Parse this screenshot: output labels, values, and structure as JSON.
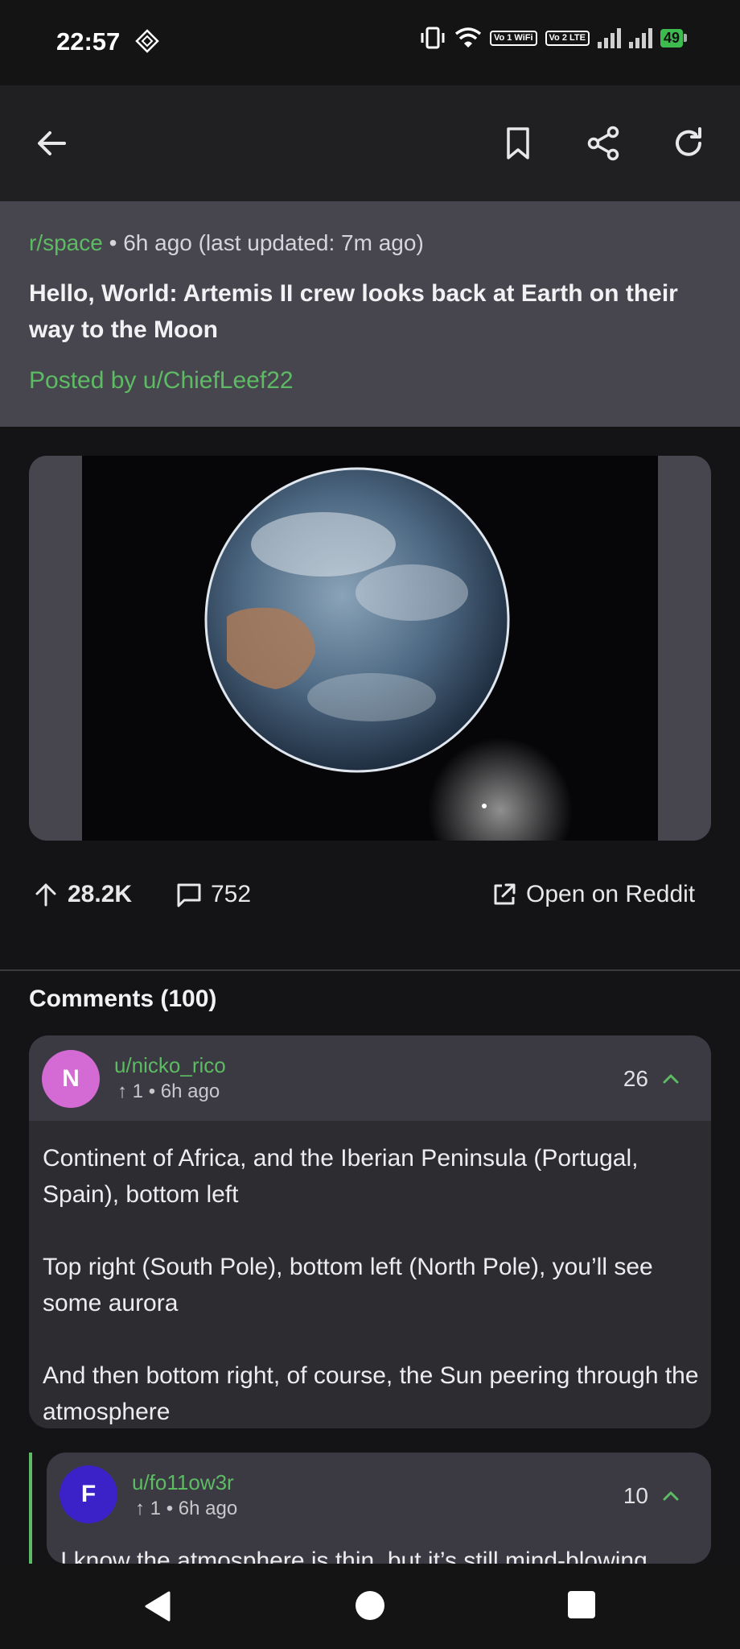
{
  "status_bar": {
    "time": "22:57",
    "sim1": "Vo 1 WiFi",
    "sim2": "Vo 2 LTE",
    "battery": "49",
    "icons": [
      "diamond-icon",
      "vibrate-icon",
      "wifi-icon",
      "signal-icon",
      "battery-icon"
    ]
  },
  "toolbar": {
    "icons": [
      "back-arrow-icon",
      "bookmark-icon",
      "share-icon",
      "refresh-icon"
    ]
  },
  "post": {
    "subreddit": "r/space",
    "time_meta": "• 6h ago (last updated: 7m ago)",
    "title": "Hello, World: Artemis II crew looks back at Earth on their way to the Moon",
    "author_line": "Posted by u/ChiefLeef22",
    "upvotes": "28.2K",
    "comment_count": "752",
    "open_label": "Open on Reddit"
  },
  "comments": {
    "header": "Comments (100)",
    "items": [
      {
        "avatar_letter": "N",
        "avatar_color": "#d46ad4",
        "username": "u/nicko_rico",
        "meta": "1 • 6h ago",
        "score": "26",
        "paragraphs": [
          "Continent of Africa, and the Iberian Peninsula (Portugal, Spain), bottom left",
          "Top right (South Pole), bottom left (North Pole), you’ll see some aurora",
          "And then bottom right, of course, the Sun peering through the atmosphere"
        ]
      },
      {
        "avatar_letter": "F",
        "avatar_color": "#3a22c8",
        "username": "u/fo11ow3r",
        "meta": "1 • 6h ago",
        "score": "10",
        "paragraphs": [
          "I know the atmosphere is thin, but it’s still mind-blowing"
        ]
      }
    ]
  },
  "colors": {
    "accent_green": "#5dbb63",
    "header_bg": "#47464f",
    "toolbar_bg": "#202022"
  }
}
